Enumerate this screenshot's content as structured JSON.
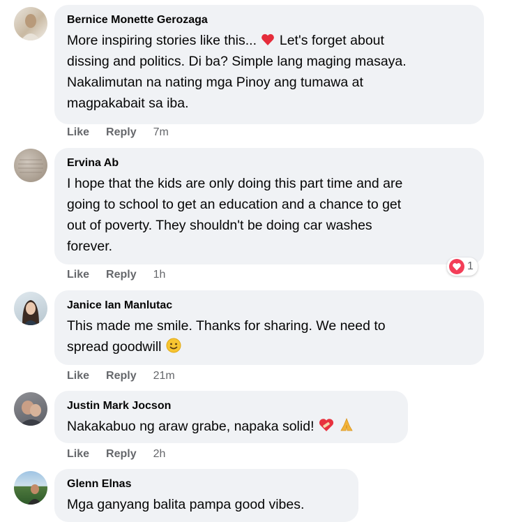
{
  "actions": {
    "like": "Like",
    "reply": "Reply"
  },
  "comments": [
    {
      "author": "Bernice Monette Gerozaga",
      "lines": [
        "More inspiring stories like this...",
        "Let's forget about",
        "dissing and politics. Di ba? Simple lang maging masaya.",
        "Nakalimutan na nating mga Pinoy ang tumawa at",
        "magpakabait sa iba."
      ],
      "time": "7m",
      "emoji": "red-heart"
    },
    {
      "author": "Ervina Ab",
      "lines": [
        "I hope that the kids are only doing this part time and are",
        "going to school to get an education and a chance to get",
        "out of poverty. They shouldn't be doing car washes",
        "forever."
      ],
      "time": "1h",
      "reaction_count": "1"
    },
    {
      "author": "Janice Ian Manlutac",
      "lines": [
        "This made me smile. Thanks for sharing. We need to",
        "spread goodwill"
      ],
      "time": "21m",
      "emoji": "smiling-face"
    },
    {
      "author": "Justin Mark Jocson",
      "lines": [
        "Nakakabuo ng araw grabe, napaka solid!"
      ],
      "time": "2h",
      "emoji": "mending-heart, folded-hands"
    },
    {
      "author": "Glenn Elnas",
      "lines": [
        "Mga ganyang balita pampa good vibes."
      ]
    }
  ],
  "colors": {
    "bubble": "#f0f2f5",
    "meta": "#65676b",
    "text": "#050505",
    "heart": "#f33e58"
  }
}
